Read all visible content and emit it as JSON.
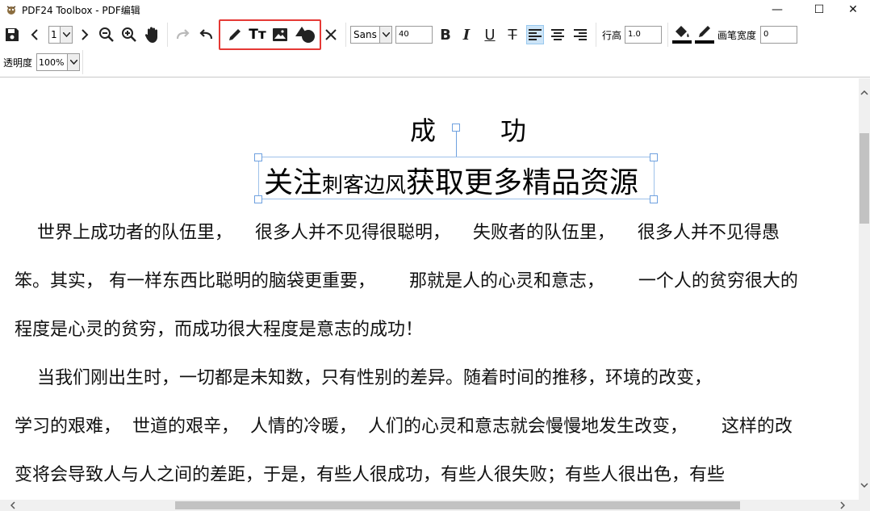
{
  "window": {
    "title": "PDF24 Toolbox - PDF编辑",
    "minimize": "—",
    "maximize": "☐",
    "close": "✕"
  },
  "toolbar": {
    "page_number": "1",
    "font_family": "Sans",
    "font_size": "40",
    "bold_label": "B",
    "italic_label": "I",
    "underline_label": "U",
    "strike_label": "T",
    "line_height_label": "行高",
    "line_height_value": "1.0",
    "stroke_width_label": "画笔宽度",
    "stroke_width_value": "0",
    "opacity_label": "透明度",
    "opacity_value": "100%",
    "text_tool_label": "Tт"
  },
  "document": {
    "title_char1": "成",
    "title_char2": "功",
    "selected_text_part1": "关注",
    "selected_text_part2": "刺客边风",
    "selected_text_part3": "获取更多精品资源",
    "lines": [
      "    世界上成功者的队伍里，    很多人并不见得很聪明，    失败者的队伍里，    很多人并不见得愚",
      "笨。其实， 有一样东西比聪明的脑袋更重要，      那就是人的心灵和意志，      一个人的贫穷很大的",
      "程度是心灵的贫穷，而成功很大程度是意志的成功！",
      "    当我们刚出生时，一切都是未知数，只有性别的差异。随着时间的推移，环境的改变，",
      "学习的艰难，  世道的艰辛，  人情的冷暖，  人们的心灵和意志就会慢慢地发生改变，      这样的改",
      "变将会导致人与人之间的差距，于是，有些人很成功，有些人很失败；有些人很出色，有些"
    ]
  },
  "colors": {
    "highlight_border": "#e53935",
    "selection": "#6fa1df"
  }
}
